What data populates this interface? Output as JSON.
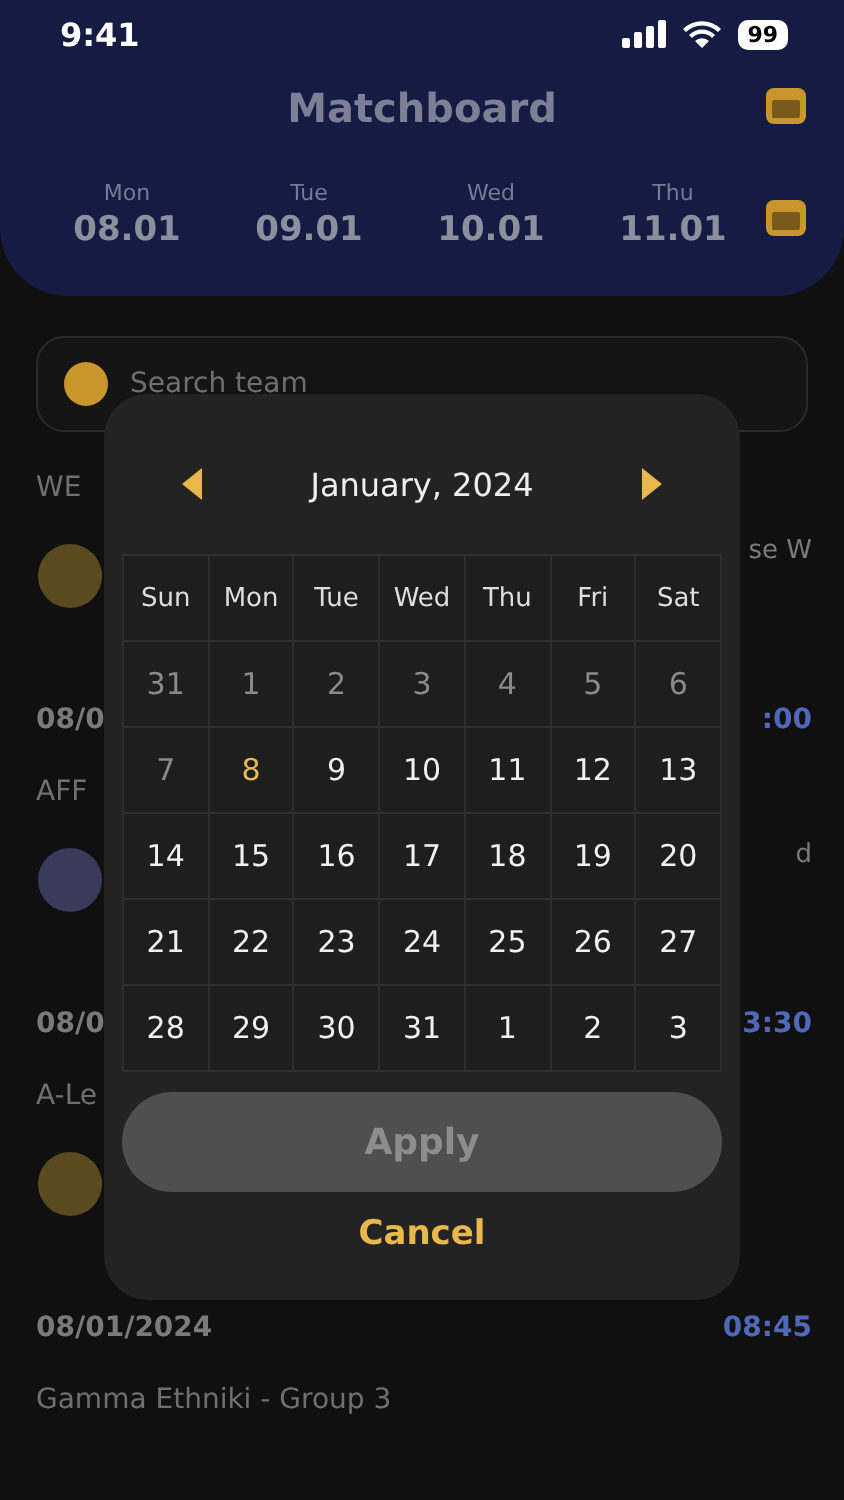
{
  "status_bar": {
    "time": "9:41",
    "battery": "99"
  },
  "header": {
    "title": "Matchboard",
    "days": [
      {
        "weekday": "Mon",
        "date": "08.01"
      },
      {
        "weekday": "Tue",
        "date": "09.01"
      },
      {
        "weekday": "Wed",
        "date": "10.01"
      },
      {
        "weekday": "Thu",
        "date": "11.01"
      }
    ]
  },
  "search": {
    "placeholder": "Search team"
  },
  "sections": [
    {
      "title": "WE",
      "match": {
        "team": "se W",
        "date": "08/0",
        "time": ":00"
      }
    },
    {
      "title": "AFF",
      "match": {
        "team": "d",
        "date": "08/0",
        "time": "3:30"
      }
    },
    {
      "title": "A-Le",
      "match": {
        "date": "08/01/2024",
        "time": "08:45"
      }
    },
    {
      "title": "Gamma Ethniki - Group 3"
    }
  ],
  "calendar": {
    "month": "January, 2024",
    "weekdays": [
      "Sun",
      "Mon",
      "Tue",
      "Wed",
      "Thu",
      "Fri",
      "Sat"
    ],
    "days": [
      {
        "label": "31",
        "disabled": true,
        "selected": false
      },
      {
        "label": "1",
        "disabled": true,
        "selected": false
      },
      {
        "label": "2",
        "disabled": true,
        "selected": false
      },
      {
        "label": "3",
        "disabled": true,
        "selected": false
      },
      {
        "label": "4",
        "disabled": true,
        "selected": false
      },
      {
        "label": "5",
        "disabled": true,
        "selected": false
      },
      {
        "label": "6",
        "disabled": true,
        "selected": false
      },
      {
        "label": "7",
        "disabled": true,
        "selected": false
      },
      {
        "label": "8",
        "disabled": false,
        "selected": true
      },
      {
        "label": "9",
        "disabled": false,
        "selected": false
      },
      {
        "label": "10",
        "disabled": false,
        "selected": false
      },
      {
        "label": "11",
        "disabled": false,
        "selected": false
      },
      {
        "label": "12",
        "disabled": false,
        "selected": false
      },
      {
        "label": "13",
        "disabled": false,
        "selected": false
      },
      {
        "label": "14",
        "disabled": false,
        "selected": false
      },
      {
        "label": "15",
        "disabled": false,
        "selected": false
      },
      {
        "label": "16",
        "disabled": false,
        "selected": false
      },
      {
        "label": "17",
        "disabled": false,
        "selected": false
      },
      {
        "label": "18",
        "disabled": false,
        "selected": false
      },
      {
        "label": "19",
        "disabled": false,
        "selected": false
      },
      {
        "label": "20",
        "disabled": false,
        "selected": false
      },
      {
        "label": "21",
        "disabled": false,
        "selected": false
      },
      {
        "label": "22",
        "disabled": false,
        "selected": false
      },
      {
        "label": "23",
        "disabled": false,
        "selected": false
      },
      {
        "label": "24",
        "disabled": false,
        "selected": false
      },
      {
        "label": "25",
        "disabled": false,
        "selected": false
      },
      {
        "label": "26",
        "disabled": false,
        "selected": false
      },
      {
        "label": "27",
        "disabled": false,
        "selected": false
      },
      {
        "label": "28",
        "disabled": false,
        "selected": false
      },
      {
        "label": "29",
        "disabled": false,
        "selected": false
      },
      {
        "label": "30",
        "disabled": false,
        "selected": false
      },
      {
        "label": "31",
        "disabled": false,
        "selected": false
      },
      {
        "label": "1",
        "disabled": false,
        "selected": false
      },
      {
        "label": "2",
        "disabled": false,
        "selected": false
      },
      {
        "label": "3",
        "disabled": false,
        "selected": false
      }
    ],
    "apply": {
      "label": "Apply",
      "disabled": true
    },
    "cancel": "Cancel"
  }
}
